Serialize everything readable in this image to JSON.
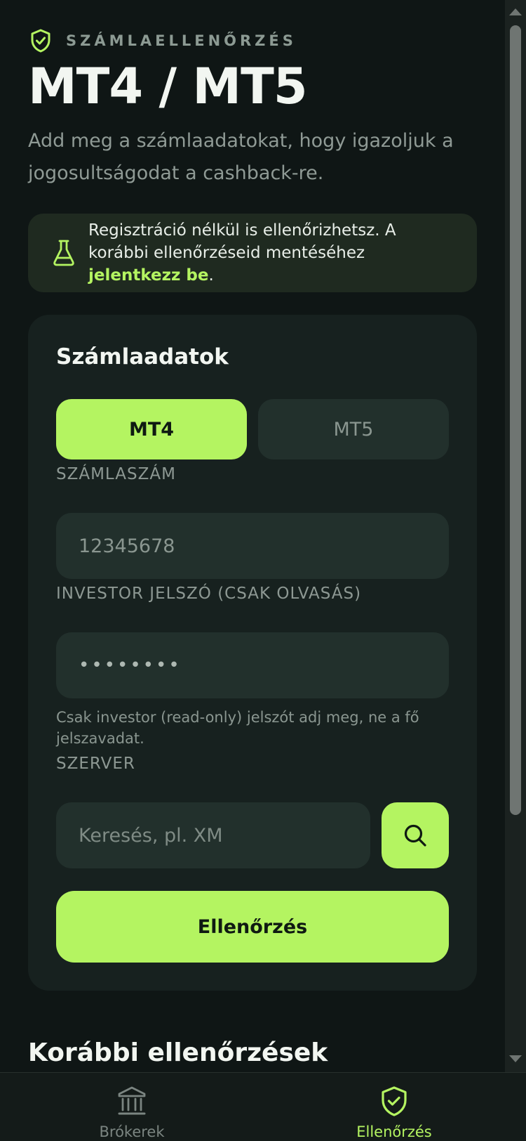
{
  "header": {
    "eyebrow": "SZÁMLAELLENŐRZÉS",
    "title": "MT4 / MT5",
    "subtitle": "Add meg a számlaadatokat, hogy igazoljuk a jogosultságodat a cashback-re."
  },
  "notice": {
    "text_before": "Regisztráció nélkül is ellenőrizhetsz. A korábbi ellenőrzéseid mentéséhez ",
    "link": "jelentkezz be",
    "text_after": ".",
    "icon": "flask-icon"
  },
  "form": {
    "title": "Számlaadatok",
    "platforms": [
      {
        "label": "MT4",
        "selected": true
      },
      {
        "label": "MT5",
        "selected": false
      }
    ],
    "account_label": "SZÁMLASZÁM",
    "account_placeholder": "12345678",
    "password_label": "INVESTOR JELSZÓ (CSAK OLVASÁS)",
    "password_placeholder": "••••••••",
    "password_hint": "Csak investor (read-only) jelszót adj meg, ne a fő jelszavadat.",
    "server_label": "SZERVER",
    "server_placeholder": "Keresés, pl. XM",
    "submit_label": "Ellenőrzés"
  },
  "history": {
    "title": "Korábbi ellenőrzések"
  },
  "bottom_nav": {
    "items": [
      {
        "label": "Brókerek",
        "icon": "bank-icon",
        "active": false
      },
      {
        "label": "Ellenőrzés",
        "icon": "shield-check-icon",
        "active": true
      }
    ]
  },
  "colors": {
    "background": "#0f1615",
    "card": "#17211f",
    "accent": "#b4f461",
    "notice_bg": "#1f2a20"
  }
}
